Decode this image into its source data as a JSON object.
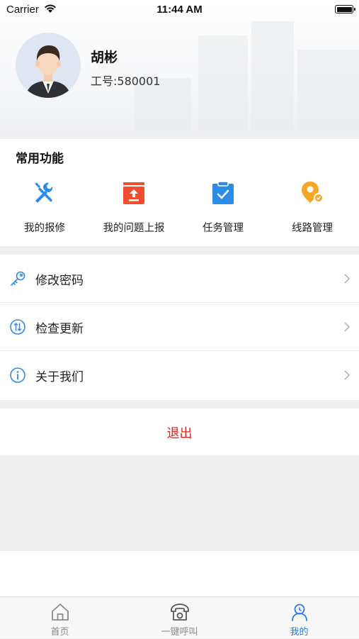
{
  "status_bar": {
    "carrier": "Carrier",
    "time": "11:44 AM"
  },
  "profile": {
    "name": "胡彬",
    "employee_id": "工号:580001"
  },
  "functions": {
    "title": "常用功能",
    "items": [
      {
        "label": "我的报修",
        "icon": "repair-tools-icon",
        "color": "#2b8be6"
      },
      {
        "label": "我的问题上报",
        "icon": "issue-report-icon",
        "color": "#f04e30"
      },
      {
        "label": "任务管理",
        "icon": "task-clipboard-icon",
        "color": "#2b8be6"
      },
      {
        "label": "线路管理",
        "icon": "route-location-icon",
        "color": "#f5a623"
      }
    ]
  },
  "settings": {
    "items": [
      {
        "label": "修改密码",
        "icon": "key-icon"
      },
      {
        "label": "检查更新",
        "icon": "update-icon"
      },
      {
        "label": "关于我们",
        "icon": "info-icon"
      }
    ]
  },
  "logout": {
    "label": "退出",
    "color": "#e02020"
  },
  "tab_bar": {
    "tabs": [
      {
        "label": "首页",
        "icon": "home-icon",
        "active": false
      },
      {
        "label": "一键呼叫",
        "icon": "phone-icon",
        "active": false
      },
      {
        "label": "我的",
        "icon": "profile-icon",
        "active": true
      }
    ],
    "active_color": "#2a7ce3",
    "inactive_color": "#8a8a8a"
  }
}
